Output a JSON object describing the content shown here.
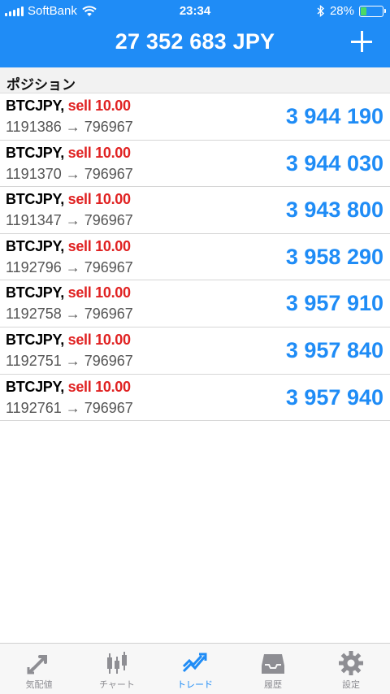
{
  "status_bar": {
    "carrier": "SoftBank",
    "time": "23:34",
    "battery_percent": "28%",
    "battery_level": 0.28
  },
  "header": {
    "title": "27 352 683 JPY",
    "add_icon": "plus-icon"
  },
  "section": {
    "title": "ポジション"
  },
  "positions": [
    {
      "symbol": "BTCJPY,",
      "side": "sell 10.00",
      "route": "1191386 → 796967",
      "price": "3 944 190"
    },
    {
      "symbol": "BTCJPY,",
      "side": "sell 10.00",
      "route": "1191370 → 796967",
      "price": "3 944 030"
    },
    {
      "symbol": "BTCJPY,",
      "side": "sell 10.00",
      "route": "1191347 → 796967",
      "price": "3 943 800"
    },
    {
      "symbol": "BTCJPY,",
      "side": "sell 10.00",
      "route": "1192796 → 796967",
      "price": "3 958 290"
    },
    {
      "symbol": "BTCJPY,",
      "side": "sell 10.00",
      "route": "1192758 → 796967",
      "price": "3 957 910"
    },
    {
      "symbol": "BTCJPY,",
      "side": "sell 10.00",
      "route": "1192751 → 796967",
      "price": "3 957 840"
    },
    {
      "symbol": "BTCJPY,",
      "side": "sell 10.00",
      "route": "1192761 → 796967",
      "price": "3 957 940"
    }
  ],
  "tabs": [
    {
      "label": "気配値",
      "icon": "quotes-arrows-icon",
      "active": false
    },
    {
      "label": "チャート",
      "icon": "candlestick-chart-icon",
      "active": false
    },
    {
      "label": "トレード",
      "icon": "trade-trend-icon",
      "active": true
    },
    {
      "label": "履歴",
      "icon": "history-inbox-icon",
      "active": false
    },
    {
      "label": "設定",
      "icon": "settings-gear-icon",
      "active": false
    }
  ],
  "colors": {
    "accent": "#1f8cf6",
    "sell": "#e02222",
    "battery": "#4cd964",
    "inactive_icon": "#8e8e93"
  }
}
